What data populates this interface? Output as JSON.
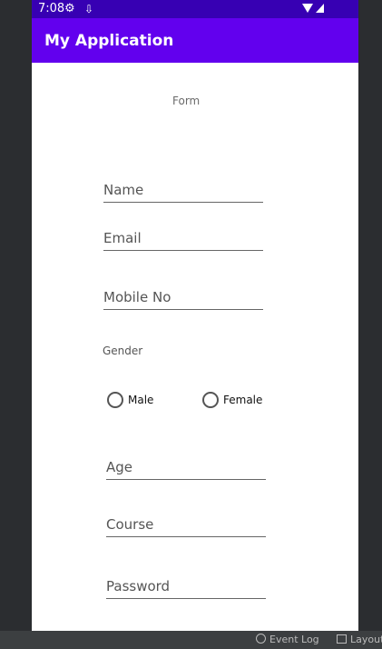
{
  "status_bar": {
    "time": "7:08",
    "icons": [
      "settings-icon",
      "download-icon",
      "wifi-icon",
      "signal-icon"
    ]
  },
  "app_bar": {
    "title": "My Application"
  },
  "form": {
    "title": "Form",
    "fields": {
      "name": {
        "placeholder": "Name"
      },
      "email": {
        "placeholder": "Email"
      },
      "mobile": {
        "placeholder": "Mobile No"
      },
      "age": {
        "placeholder": "Age"
      },
      "course": {
        "placeholder": "Course"
      },
      "password": {
        "placeholder": "Password"
      }
    },
    "gender_label": "Gender",
    "gender_options": {
      "male": "Male",
      "female": "Female"
    }
  },
  "ide_bar": {
    "event_log": "Event Log",
    "layout": "Layout"
  },
  "colors": {
    "status_bar": "#3700b3",
    "app_bar": "#6200ee"
  }
}
